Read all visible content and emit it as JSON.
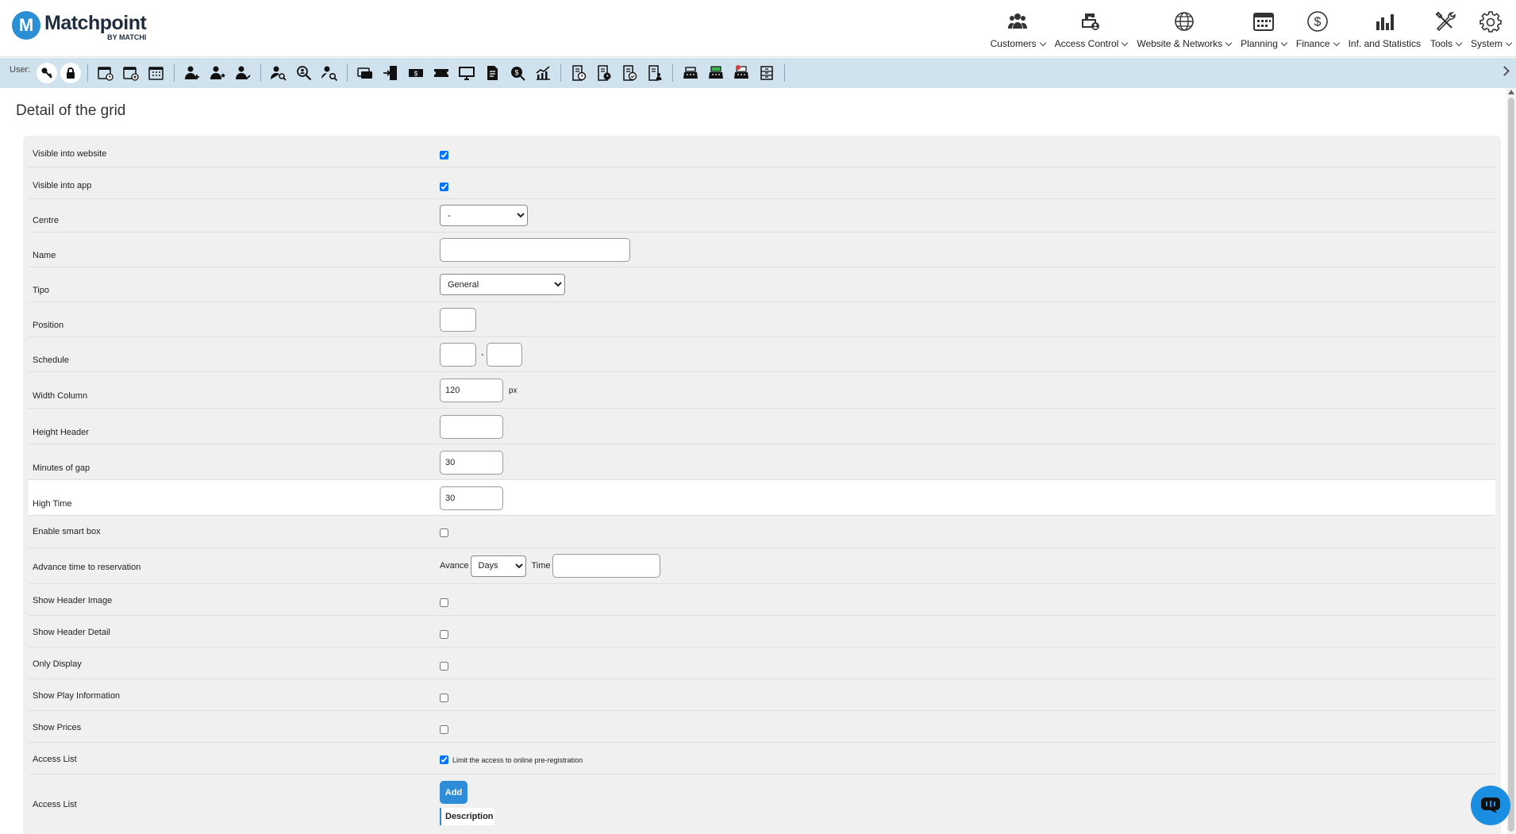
{
  "brand": {
    "name": "Matchpoint",
    "byline": "BY MATCHI",
    "letter": "M",
    "color": "#2a8fd4"
  },
  "nav": [
    {
      "label": "Customers",
      "icon": "users-icon"
    },
    {
      "label": "Access Control",
      "icon": "access-lock-icon"
    },
    {
      "label": "Website & Networks",
      "icon": "globe-icon"
    },
    {
      "label": "Planning",
      "icon": "calendar-icon"
    },
    {
      "label": "Finance",
      "icon": "dollar-icon"
    },
    {
      "label": "Inf. and Statistics",
      "icon": "bar-chart-icon"
    },
    {
      "label": "Tools",
      "icon": "tools-icon"
    },
    {
      "label": "System",
      "icon": "gear-icon"
    }
  ],
  "toolbar": {
    "user_label": "User:",
    "accent": "#cfe2ee"
  },
  "page": {
    "title": "Detail of the grid"
  },
  "form": {
    "visible_website": {
      "label": "Visible into website",
      "checked": true
    },
    "visible_app": {
      "label": "Visible into app",
      "checked": true
    },
    "centre": {
      "label": "Centre",
      "value": "-"
    },
    "name": {
      "label": "Name",
      "value": ""
    },
    "tipo": {
      "label": "Tipo",
      "value": "General"
    },
    "position": {
      "label": "Position",
      "value": ""
    },
    "schedule": {
      "label": "Schedule",
      "from": "",
      "separator": "-",
      "to": ""
    },
    "width_column": {
      "label": "Width Column",
      "value": "120",
      "unit": "px"
    },
    "height_header": {
      "label": "Height Header",
      "value": ""
    },
    "minutes_gap": {
      "label": "Minutes of gap",
      "value": "30"
    },
    "high_time": {
      "label": "High Time",
      "value": "30"
    },
    "smart_box": {
      "label": "Enable smart box",
      "checked": false
    },
    "advance_time": {
      "label": "Advance time to reservation",
      "avance_label": "Avance",
      "avance_value": "Days",
      "time_label": "Time",
      "time_value": ""
    },
    "show_header_image": {
      "label": "Show Header Image",
      "checked": false
    },
    "show_header_detail": {
      "label": "Show Header Detail",
      "checked": false
    },
    "only_display": {
      "label": "Only Display",
      "checked": false
    },
    "show_play_info": {
      "label": "Show Play Information",
      "checked": false
    },
    "show_prices": {
      "label": "Show Prices",
      "checked": false
    },
    "access_list_limit": {
      "label": "Access List",
      "checkbox_text": "Limit the access to online pre-registration",
      "checked": true
    },
    "access_list": {
      "label": "Access List",
      "add_label": "Add",
      "column_header": "Description"
    }
  }
}
